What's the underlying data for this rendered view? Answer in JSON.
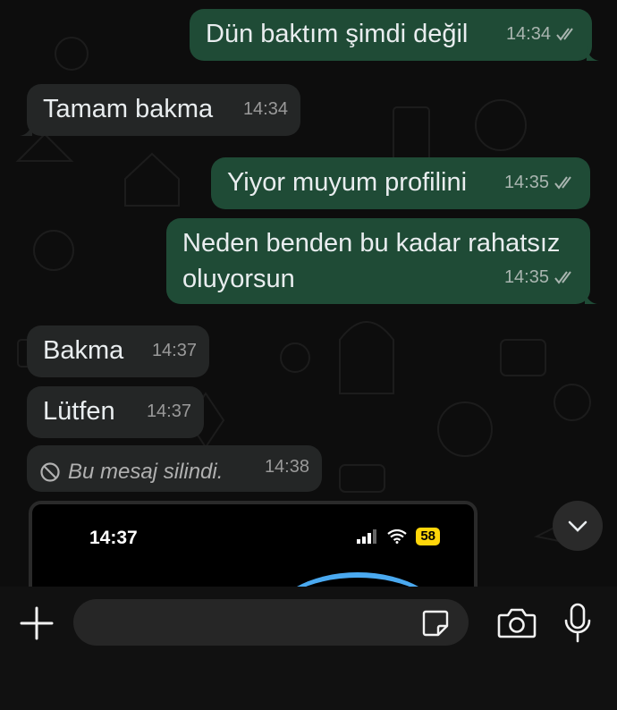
{
  "messages": [
    {
      "direction": "out",
      "text": "Dün baktım şimdi değil",
      "time": "14:34",
      "status": "read"
    },
    {
      "direction": "in",
      "text": "Tamam bakma",
      "time": "14:34"
    },
    {
      "direction": "out",
      "text": "Yiyor muyum profilini",
      "time": "14:35",
      "status": "read"
    },
    {
      "direction": "out",
      "text_line1": "Neden benden bu kadar rahatsız",
      "text_line2": "oluyorsun",
      "time": "14:35",
      "status": "read"
    },
    {
      "direction": "in",
      "text": "Bakma",
      "time": "14:37"
    },
    {
      "direction": "in",
      "text": "Lütfen",
      "time": "14:37"
    },
    {
      "direction": "in",
      "deleted": true,
      "text": "Bu mesaj silindi.",
      "time": "14:38"
    }
  ],
  "image_preview": {
    "status_time": "14:37",
    "battery": "58"
  },
  "composer": {
    "placeholder": "",
    "icons": [
      "plus-icon",
      "sticker-icon",
      "camera-icon",
      "microphone-icon"
    ]
  },
  "colors": {
    "outgoing_bubble": "#1f4b36",
    "incoming_bubble": "#242626",
    "background": "#0d0d0d",
    "accent_blue": "#4aa9f0",
    "battery_yellow": "#ffd60a"
  }
}
